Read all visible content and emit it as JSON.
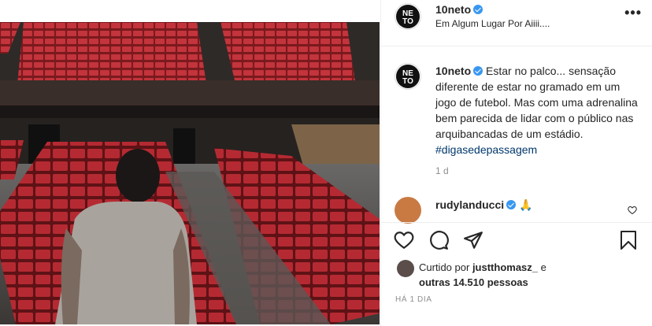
{
  "post": {
    "author": "10neto",
    "location": "Em Algum Lugar Por Aiiii....",
    "more_label": "•••",
    "caption": {
      "username": "10neto",
      "text": "Estar no palco... sensação diferente de estar no gramado em um jogo de futebol. Mas com uma adrenalina bem parecida de lidar com o público nas arquibancadas de um estádio.",
      "hashtag": "#digasedepassagem"
    },
    "caption_age": "1 d",
    "comment": {
      "username": "rudylanducci",
      "emoji": "🙏"
    },
    "likes": {
      "prefix": "Curtido por",
      "user": "justthomasz_",
      "connector": "e",
      "others": "outras 14.510 pessoas"
    },
    "posted_ago": "HÁ 1 DIA"
  },
  "colors": {
    "verified": "#3897f0",
    "hashtag": "#00376b",
    "muted": "#8e8e8e",
    "seats": "#b3232c"
  },
  "icons": [
    "heart-icon",
    "comment-icon",
    "share-icon",
    "bookmark-icon",
    "more-options-icon",
    "verified-icon"
  ]
}
